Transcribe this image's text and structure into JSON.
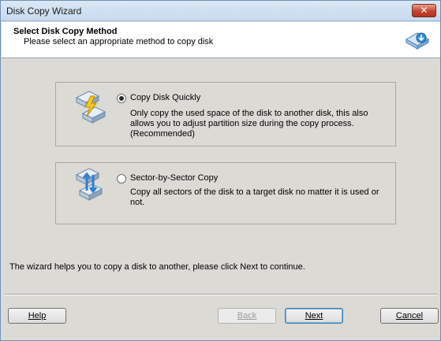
{
  "window": {
    "title": "Disk Copy Wizard",
    "close_label": "✕"
  },
  "header": {
    "title": "Select Disk Copy Method",
    "subtitle": "Please select an appropriate method to copy disk",
    "icon": "disk-copy-icon"
  },
  "options": [
    {
      "label": "Copy Disk Quickly",
      "description": "Only copy the used space of the disk to another disk, this also allows you to adjust partition size during the copy process.(Recommended)",
      "selected": true,
      "icon": "quick-copy-icon"
    },
    {
      "label": "Sector-by-Sector Copy",
      "description": "Copy all sectors of the disk to a target disk no matter it is used or not.",
      "selected": false,
      "icon": "sector-copy-icon"
    }
  ],
  "info_text": "The wizard helps you to copy a disk to another, please click Next to continue.",
  "buttons": {
    "help": "Help",
    "back": "Back",
    "next": "Next",
    "cancel": "Cancel"
  },
  "colors": {
    "titlebar": "#c6d9ee",
    "content_bg": "#dcdad5",
    "close_button": "#c5422d",
    "default_button_border": "#3c7fb1"
  }
}
